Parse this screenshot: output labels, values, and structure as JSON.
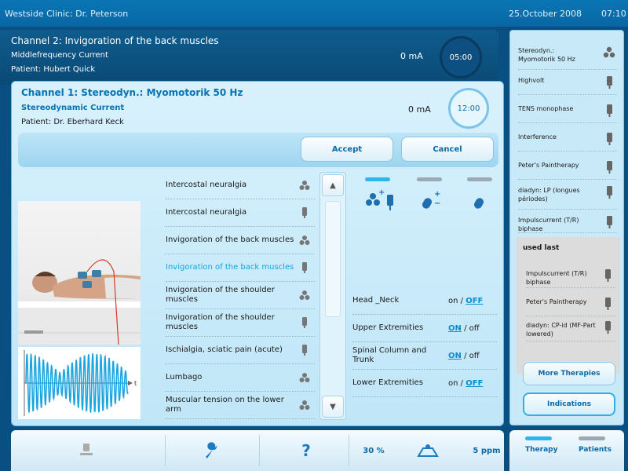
{
  "topbar": {
    "title": "Westside Clinic: Dr. Peterson",
    "date": "25.October 2008",
    "time": "07:10"
  },
  "background_channel": {
    "title": "Channel 2: Invigoration of the back muscles",
    "current": "Middlefrequency Current",
    "patient": "Patient: Hubert Quick",
    "intensity": "0 mA",
    "timer": "05:00"
  },
  "dialog": {
    "title": "Channel 1: Stereodyn.: Myomotorik 50 Hz",
    "current": "Stereodynamic Current",
    "patient": "Patient: Dr. Eberhard Keck",
    "intensity": "0 mA",
    "timer": "12:00",
    "accept_label": "Accept",
    "cancel_label": "Cancel"
  },
  "therapy_list": [
    {
      "label": "Intercostal neuralgia",
      "icon": "electrode-cluster-icon",
      "selected": false
    },
    {
      "label": "Intercostal neuralgia",
      "icon": "electrode-pad-icon",
      "selected": false
    },
    {
      "label": "Invigoration of the back muscles",
      "icon": "electrode-cluster-icon",
      "selected": false
    },
    {
      "label": "Invigoration of the back muscles",
      "icon": "electrode-pad-icon",
      "selected": true
    },
    {
      "label": "Invigoration of the shoulder muscles",
      "icon": "electrode-cluster-icon",
      "selected": false
    },
    {
      "label": "Invigoration of the shoulder muscles",
      "icon": "electrode-pad-icon",
      "selected": false
    },
    {
      "label": "Ischialgia, sciatic pain (acute)",
      "icon": "electrode-pad-icon",
      "selected": false
    },
    {
      "label": "Lumbago",
      "icon": "electrode-cluster-icon",
      "selected": false
    },
    {
      "label": "Muscular tension on the lower arm",
      "icon": "electrode-cluster-icon",
      "selected": false
    }
  ],
  "electrodes": {
    "plus_sign": "+",
    "minus_sign": "−"
  },
  "indications": [
    {
      "label": "Head _Neck",
      "on": "on",
      "off": "OFF",
      "state": "off"
    },
    {
      "label": "Upper Extremities",
      "on": "ON",
      "off": "off",
      "state": "on"
    },
    {
      "label": "Spinal Column and Trunk",
      "on": "ON",
      "off": "off",
      "state": "on"
    },
    {
      "label": "Lower Extremities",
      "on": "on",
      "off": "OFF",
      "state": "off"
    }
  ],
  "toggle_separator": "/",
  "right_panel": {
    "channels": [
      {
        "label": "Stereodyn.: Myomotorik 50 Hz",
        "icon": "electrode-cluster-icon"
      },
      {
        "label": "Highvolt",
        "icon": "electrode-pad-icon"
      },
      {
        "label": "TENS monophase",
        "icon": "electrode-pad-icon"
      },
      {
        "label": "Interference",
        "icon": "electrode-pad-icon"
      },
      {
        "label": "Peter's Paintherapy",
        "icon": "electrode-pad-icon"
      },
      {
        "label": "diadyn: LP (longues périodes)",
        "icon": "electrode-pad-icon"
      },
      {
        "label": "Impulscurrent (T/R) biphase",
        "icon": "electrode-pad-icon"
      }
    ],
    "used_last_title": "used last",
    "used_last": [
      {
        "label": "Impulscurrent (T/R) biphase"
      },
      {
        "label": "Peter's Paintherapy"
      },
      {
        "label": "diadyn: CP-id (MF-Part lowered)"
      }
    ],
    "more_therapies_label": "More Therapies",
    "indications_label": "Indications"
  },
  "bottombar": {
    "intensity_percent": "30 %",
    "rate": "5 ppm",
    "help_label": "?",
    "therapy_tab": "Therapy",
    "patients_tab": "Patients"
  },
  "wave_axis": {
    "x_label": "t"
  },
  "colors": {
    "accent": "#2fb5ec",
    "selected_text": "#12a3e0",
    "header": "#0a76b5",
    "link": "#0a8cd0"
  }
}
